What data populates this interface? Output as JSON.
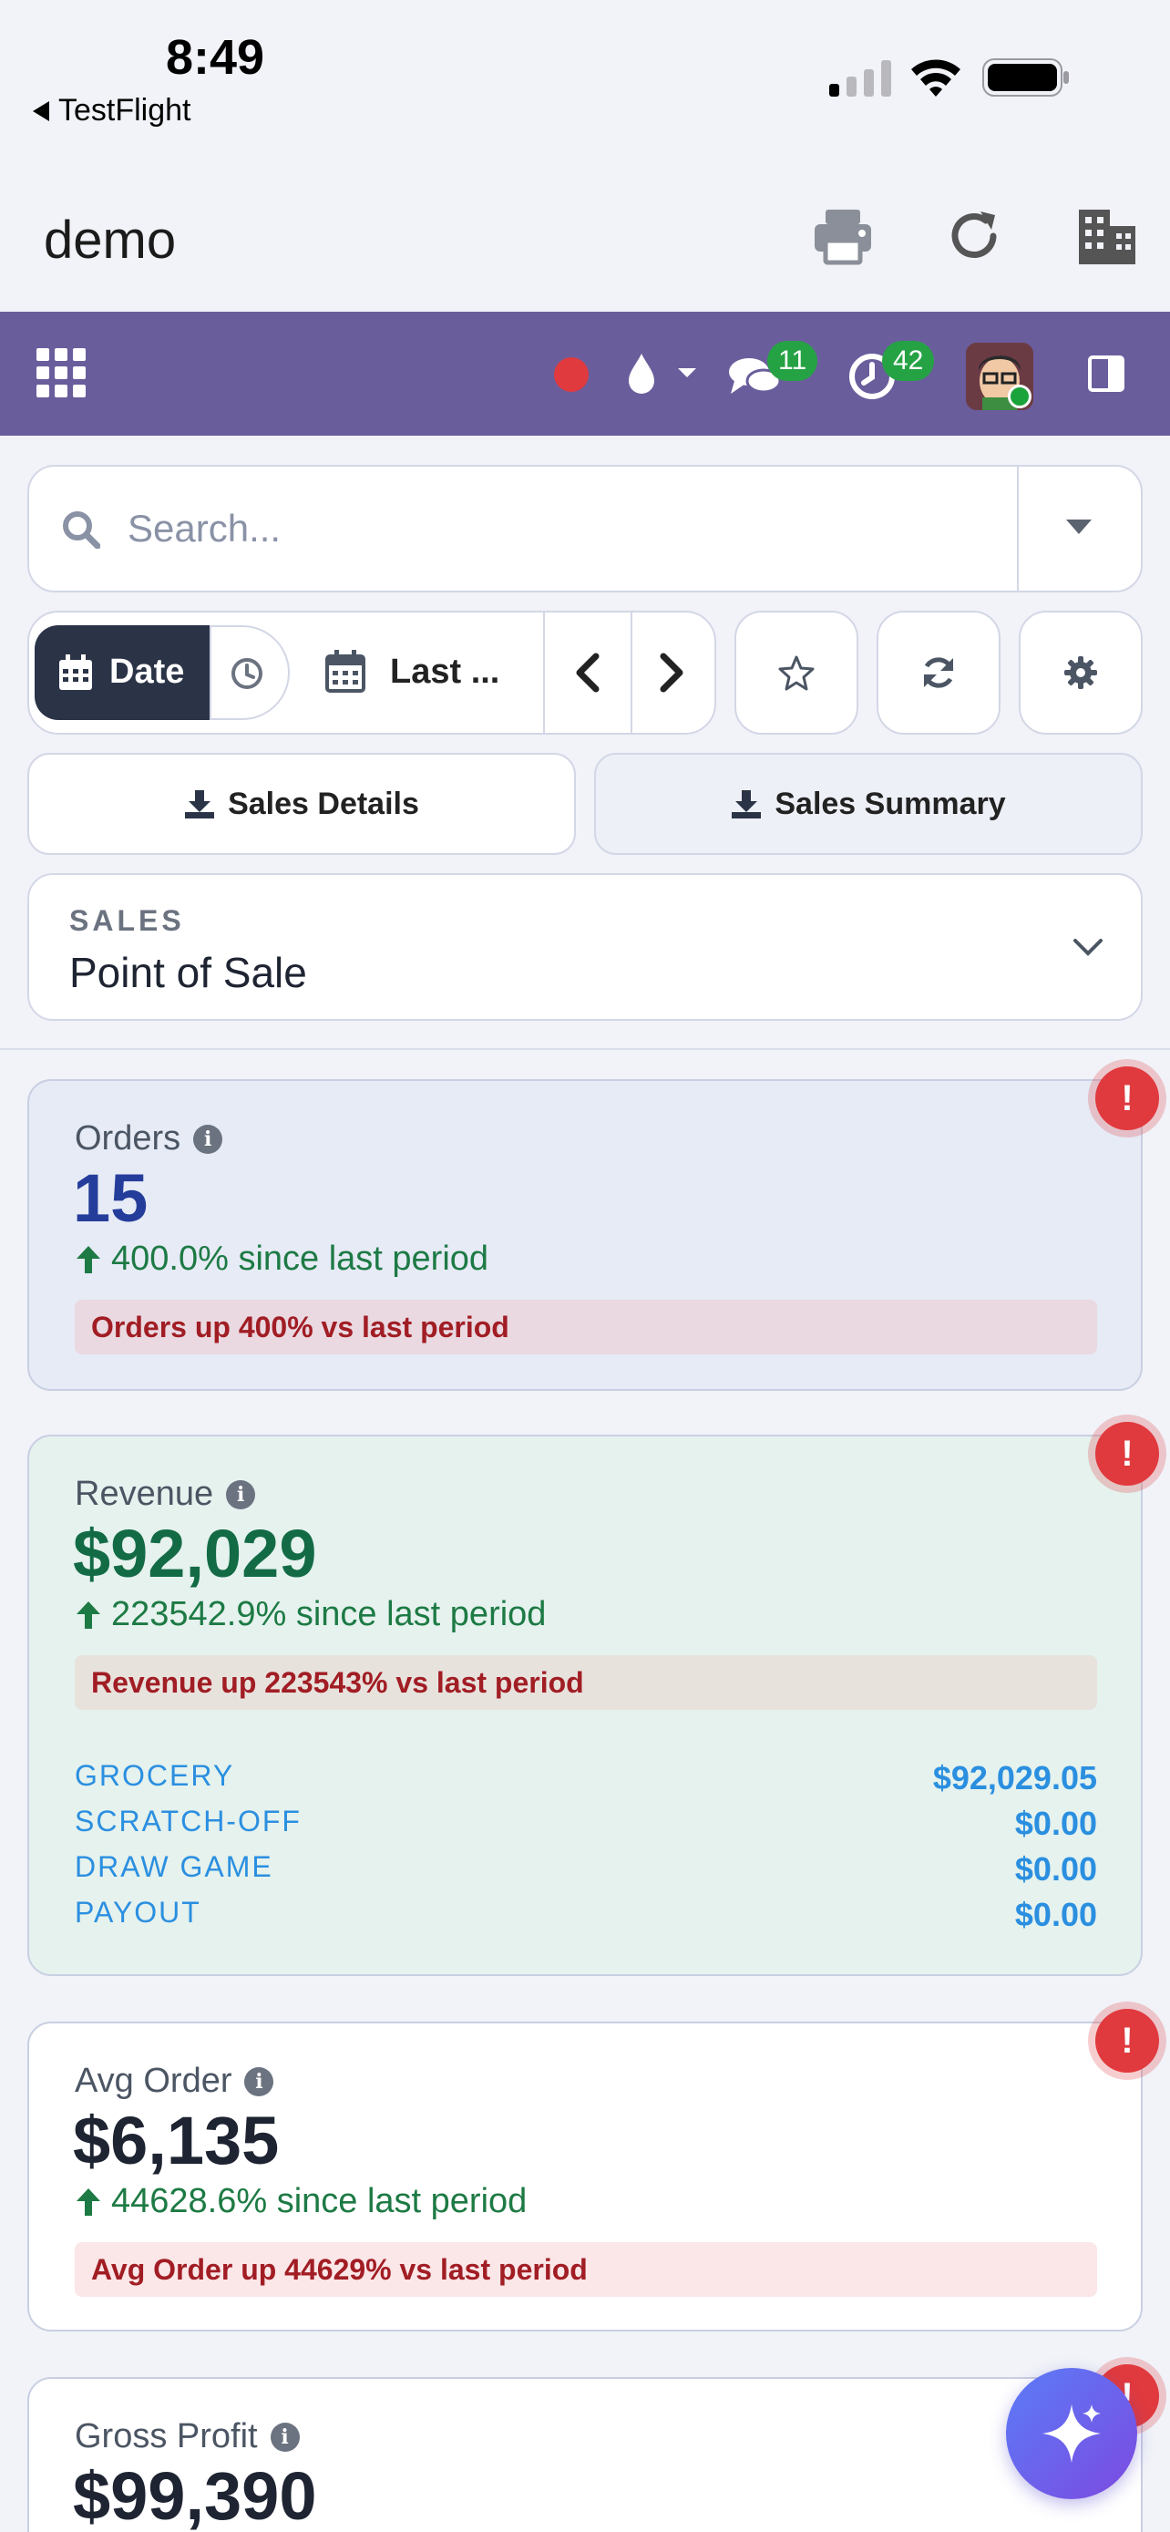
{
  "status_bar": {
    "time": "8:49",
    "back_app": "TestFlight"
  },
  "app": {
    "title": "demo"
  },
  "navbar": {
    "messages_count": "11",
    "activities_count": "42"
  },
  "search": {
    "placeholder": "Search..."
  },
  "filters": {
    "date_label": "Date",
    "range_label": "Last ...",
    "export_details": "Sales Details",
    "export_summary": "Sales Summary"
  },
  "selector": {
    "overline": "SALES",
    "value": "Point of Sale"
  },
  "cards": {
    "orders": {
      "title": "Orders",
      "value": "15",
      "change": "400.0% since last period",
      "alert": "Orders up 400% vs last period",
      "value_color": "#253d9a"
    },
    "revenue": {
      "title": "Revenue",
      "value": "$92,029",
      "change": "223542.9% since last period",
      "alert": "Revenue up 223543% vs last period",
      "value_color": "#136b46",
      "breakdown": [
        {
          "label": "GROCERY",
          "value": "$92,029.05"
        },
        {
          "label": "SCRATCH-OFF",
          "value": "$0.00"
        },
        {
          "label": "DRAW GAME",
          "value": "$0.00"
        },
        {
          "label": "PAYOUT",
          "value": "$0.00"
        }
      ]
    },
    "avg_order": {
      "title": "Avg Order",
      "value": "$6,135",
      "change": "44628.6% since last period",
      "alert": "Avg Order up 44629% vs last period",
      "value_color": "#1f2433"
    },
    "gross_profit": {
      "title": "Gross Profit",
      "value": "$99,390",
      "value_color": "#1f2433"
    }
  },
  "colors": {
    "brand_purple": "#6a5d9c",
    "positive_green": "#1d7a44",
    "alert_red": "#e03a3e",
    "badge_green": "#25a244"
  }
}
